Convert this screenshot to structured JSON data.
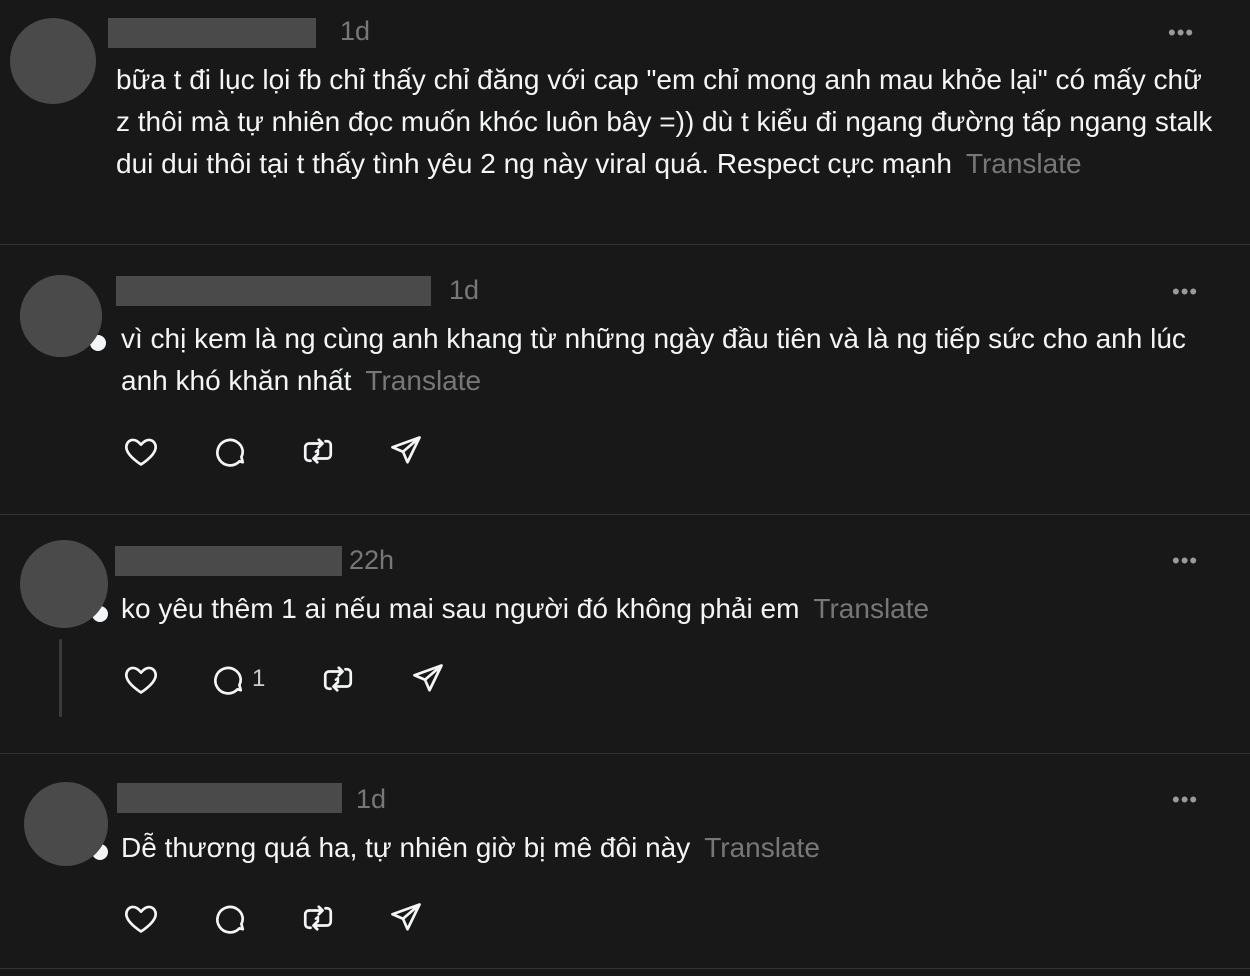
{
  "comments": [
    {
      "time": "1d",
      "text": "bữa t đi lục lọi fb chỉ thấy chỉ đăng với cap \"em chỉ mong anh mau khỏe lại\" có mấy chữ z thôi mà tự nhiên đọc muốn khóc luôn bây =)) dù t kiểu đi ngang đường tấp ngang stalk dui dui thôi tại t thấy tình yêu 2 ng này viral quá. Respect cực mạnh",
      "translate": "Translate",
      "more": "•••"
    },
    {
      "time": "1d",
      "text": "vì chị kem là ng cùng anh khang từ những ngày đầu tiên và là ng tiếp sức cho anh lúc anh khó khăn nhất",
      "translate": "Translate",
      "more": "•••",
      "reply_count": ""
    },
    {
      "time": "22h",
      "text": "ko yêu thêm 1 ai nếu mai sau người đó không phải em",
      "translate": "Translate",
      "more": "•••",
      "reply_count": "1"
    },
    {
      "time": "1d",
      "text": "Dễ thương quá ha, tự nhiên giờ bị mê đôi này",
      "translate": "Translate",
      "more": "•••",
      "reply_count": ""
    }
  ],
  "icons": {
    "like": "heart-icon",
    "reply": "comment-icon",
    "repost": "repost-icon",
    "share": "share-icon"
  },
  "colors": {
    "background": "#181818",
    "text": "#f3f5f7",
    "muted": "#777777",
    "divider": "#333333",
    "avatar": "#4a4a4a"
  }
}
